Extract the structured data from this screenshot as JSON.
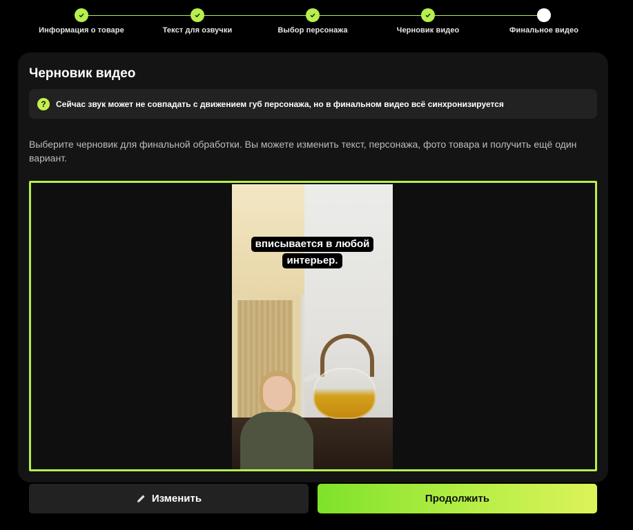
{
  "stepper": {
    "steps": [
      {
        "label": "Информация о товаре",
        "state": "done"
      },
      {
        "label": "Текст для озвучки",
        "state": "done"
      },
      {
        "label": "Выбор персонажа",
        "state": "done"
      },
      {
        "label": "Черновик видео",
        "state": "done"
      },
      {
        "label": "Финальное видео",
        "state": "current"
      }
    ],
    "accent_color": "#b8ee4d"
  },
  "card": {
    "title": "Черновик видео",
    "notice": {
      "icon": "question-circle-icon",
      "text": "Сейчас звук может не совпадать с движением губ персонажа, но в финальном видео всё синхронизируется"
    },
    "description": "Выберите черновик для финальной обработки. Вы можете изменить текст, персонажа, фото товара и получить ещё один вариант."
  },
  "video": {
    "caption_line1": "вписывается в любой",
    "caption_line2": "интерьер."
  },
  "actions": {
    "edit_label": "Изменить",
    "edit_icon": "pencil-icon",
    "continue_label": "Продолжить"
  }
}
